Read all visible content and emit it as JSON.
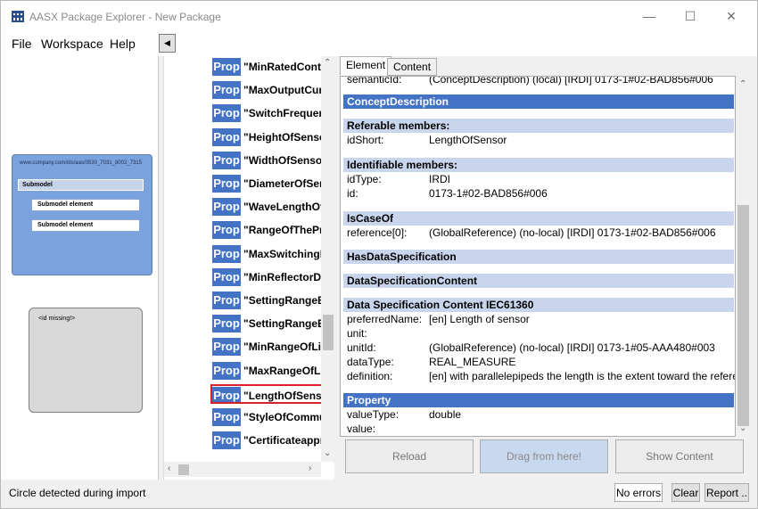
{
  "window": {
    "title": "AASX Package Explorer - New Package"
  },
  "menu": {
    "items": [
      "File",
      "Workspace",
      "Help"
    ]
  },
  "left": {
    "aas_id": "www.company.com/ids/aas/0530_7031_8002_7315",
    "submodel_label": "Submodel",
    "submodel_elements": [
      "Submodel element",
      "Submodel element"
    ],
    "asset_label": "<id missing!>"
  },
  "tree": {
    "tag": "Prop",
    "items": [
      "\"MinRatedContr",
      "\"MaxOutputCur",
      "\"SwitchFrequen",
      "\"HeightOfSenso",
      "\"WidthOfSensor",
      "\"DiameterOfSer",
      "\"WaveLengthOf",
      "\"RangeOfThePr",
      "\"MaxSwitchingD",
      "\"MinReflectorDi",
      "\"SettingRangeB",
      "\"SettingRangeEi",
      "\"MinRangeOfLig",
      "\"MaxRangeOfLi",
      "\"LengthOfSenso",
      "\"StyleOfCommu",
      "\"Certificateappr"
    ],
    "selected_index": 14
  },
  "right": {
    "tabs": [
      "Element",
      "Content"
    ],
    "semantic_row": {
      "key": "semanticId:",
      "value": "(ConceptDescription) (local) [IRDI] 0173-1#02-BAD856#006"
    },
    "concept_header": "ConceptDescription",
    "referable_header": "Referable members:",
    "idshort": {
      "key": "idShort:",
      "value": "LengthOfSensor"
    },
    "identifiable_header": "Identifiable members:",
    "idtype": {
      "key": "idType:",
      "value": "IRDI"
    },
    "id": {
      "key": "id:",
      "value": "0173-1#02-BAD856#006"
    },
    "iscaseof_header": "IsCaseOf",
    "reference": {
      "key": "reference[0]:",
      "value": "(GlobalReference) (no-local) [IRDI] 0173-1#02-BAD856#006"
    },
    "hasds_header": "HasDataSpecification",
    "dsc_header": "DataSpecificationContent",
    "iec_header": "Data Specification Content IEC61360",
    "preferred": {
      "key": "preferredName:",
      "value": "[en] Length of sensor"
    },
    "unit": {
      "key": "unit:",
      "value": ""
    },
    "unitid": {
      "key": "unitId:",
      "value": "(GlobalReference) (no-local) [IRDI] 0173-1#05-AAA480#003"
    },
    "datatype": {
      "key": "dataType:",
      "value": "REAL_MEASURE"
    },
    "definition": {
      "key": "definition:",
      "value": "[en] with parallelepipeds the length is the extent toward the reference"
    },
    "property_header": "Property",
    "valuetype": {
      "key": "valueType:",
      "value": "double"
    },
    "value": {
      "key": "value:",
      "value": ""
    },
    "buttons": {
      "reload": "Reload",
      "drag": "Drag from here!",
      "show": "Show Content"
    }
  },
  "status": {
    "text": "Circle detected during import",
    "errors": "No errors",
    "clear": "Clear",
    "report": "Report .."
  }
}
